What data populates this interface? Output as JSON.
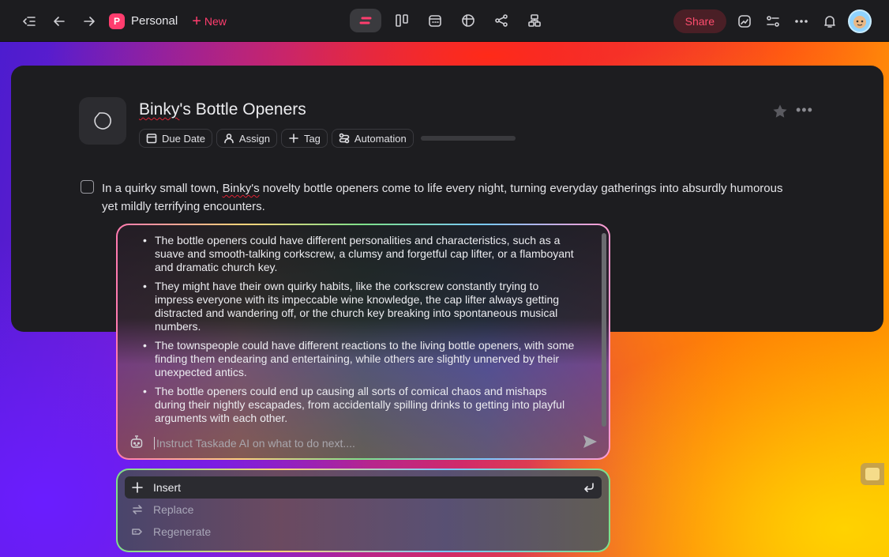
{
  "topbar": {
    "workspace_initial": "P",
    "workspace_name": "Personal",
    "new_label": "New",
    "share_label": "Share"
  },
  "project": {
    "title_prefix": "Binky",
    "title_rest": "'s Bottle Openers",
    "chips": {
      "due_date": "Due Date",
      "assign": "Assign",
      "tag": "Tag",
      "automation": "Automation"
    },
    "task": {
      "text_before": "In a quirky small town, ",
      "text_spell": "Binky's",
      "text_after": " novelty bottle openers come to life every night, turning everyday gatherings into absurdly humorous yet mildly terrifying encounters."
    }
  },
  "ai": {
    "bullets": [
      "The bottle openers could have different personalities and characteristics, such as a suave and smooth-talking corkscrew, a clumsy and forgetful cap lifter, or a flamboyant and dramatic church key.",
      "They might have their own quirky habits, like the corkscrew constantly trying to impress everyone with its impeccable wine knowledge, the cap lifter always getting distracted and wandering off, or the church key breaking into spontaneous musical numbers.",
      "The townspeople could have different reactions to the living bottle openers, with some finding them endearing and entertaining, while others are slightly unnerved by their unexpected antics.",
      "The bottle openers could end up causing all sorts of comical chaos and mishaps during their nightly escapades, from accidentally spilling drinks to getting into playful arguments with each other."
    ],
    "input_placeholder": "Instruct Taskade AI on what to do next....",
    "actions": {
      "insert": "Insert",
      "replace": "Replace",
      "regenerate": "Regenerate"
    }
  },
  "colors": {
    "accent": "#ff3d6e",
    "card_bg": "#1d1d20",
    "topbar_bg": "#1c1c1f"
  }
}
